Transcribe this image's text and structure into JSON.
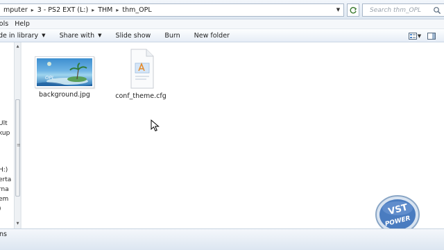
{
  "address": {
    "breadcrumbs": [
      "mputer",
      "3 - PS2 EXT (L:)",
      "THM",
      "thm_OPL"
    ],
    "search_placeholder": "Search thm_OPL"
  },
  "menu": [
    "ools",
    "Help"
  ],
  "commands": {
    "include_library": "ude in library",
    "share_with": "Share with",
    "slide_show": "Slide show",
    "burn": "Burn",
    "new_folder": "New folder"
  },
  "nav_pane": {
    "items": [
      "Ult",
      "kup",
      "H:)",
      "erta",
      "rna",
      "em",
      ")"
    ]
  },
  "files": [
    {
      "name": "background.jpg",
      "type": "image",
      "thumb_text": "OPL"
    },
    {
      "name": "conf_theme.cfg",
      "type": "config"
    }
  ],
  "logo": {
    "line1": "VST",
    "line2": "POWER"
  },
  "details": {
    "text": "ns"
  },
  "colors": {
    "chrome_top": "#f2f6fb",
    "chrome_bottom": "#dfe8f2",
    "border": "#a9b8c9",
    "logo_blue": "#3b6fb5"
  }
}
